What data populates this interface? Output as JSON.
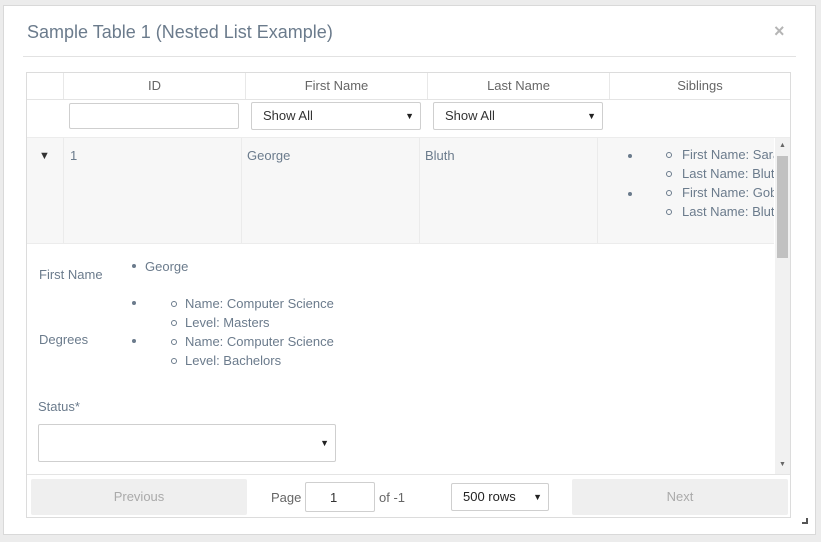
{
  "modal": {
    "title": "Sample Table 1 (Nested List Example)",
    "close_label": "×"
  },
  "table": {
    "columns": [
      "ID",
      "First Name",
      "Last Name",
      "Siblings"
    ],
    "filters": {
      "id_value": "",
      "first_name": "Show All",
      "last_name": "Show All"
    },
    "rows": [
      {
        "id": "1",
        "first_name": "George",
        "last_name": "Bluth",
        "siblings": [
          {
            "first_name": "First Name: Sara",
            "last_name": "Last Name: Blut"
          },
          {
            "first_name": "First Name: Gob",
            "last_name": "Last Name: Blut"
          }
        ]
      }
    ]
  },
  "detail": {
    "first_name_label": "First Name",
    "first_name_value": "George",
    "degrees_label": "Degrees",
    "degrees": [
      {
        "name": "Name: Computer Science",
        "level": "Level: Masters"
      },
      {
        "name": "Name: Computer Science",
        "level": "Level: Bachelors"
      }
    ],
    "status_label": "Status*",
    "status_value": ""
  },
  "pagination": {
    "previous_label": "Previous",
    "next_label": "Next",
    "page_label": "Page",
    "page_value": "1",
    "of_label": "of -1",
    "rows_label": "500 rows"
  },
  "icons": {
    "expander": "▼",
    "select_caret": "▼",
    "scroll_up": "▲",
    "scroll_down": "▼"
  }
}
